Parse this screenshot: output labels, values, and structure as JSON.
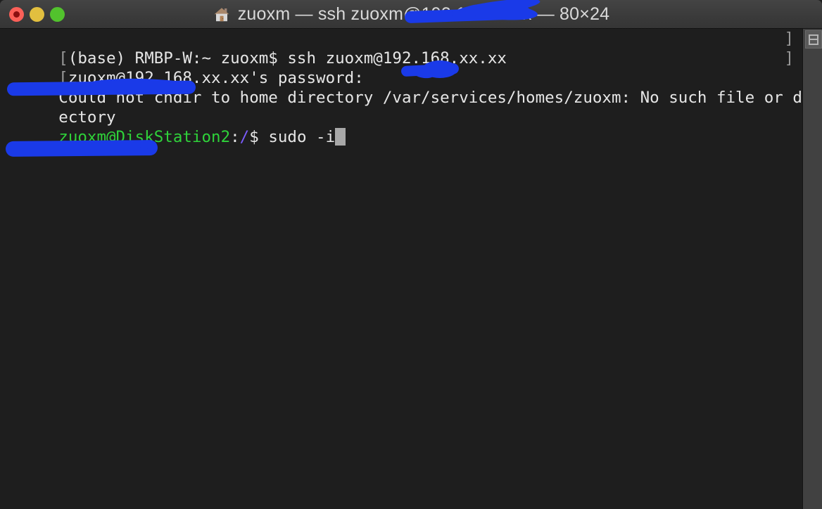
{
  "window": {
    "title_prefix": "zuoxm — ssh ",
    "title_redacted": "zuoxm@192.168.xx.xx",
    "title_suffix": " — 80×24",
    "title_full": "zuoxm — ssh zuoxm@192.168.xx.xx — 80×24",
    "home_icon": "house-icon",
    "size_label": "80×24"
  },
  "titlebar": {
    "close_label": "close",
    "minimize_label": "minimize",
    "maximize_label": "maximize"
  },
  "terminal": {
    "rows": 24,
    "cols": 80,
    "background": "#1e1e1e",
    "foreground": "#e6e6e6",
    "lines": [
      {
        "left_marker": "[",
        "right_marker": "]",
        "text": "(base) RMBP-W:~ zuoxm$ ssh zuoxm@192.168.xx.xx",
        "redacted": true
      },
      {
        "left_marker": "[",
        "right_marker": "]",
        "text": "zuoxm@192.168.xx.xx's password:",
        "redacted": true
      },
      {
        "left_marker": "",
        "right_marker": "",
        "text": "Could not chdir to home directory /var/services/homes/zuoxm: No such file or dir",
        "redacted": false
      },
      {
        "left_marker": "",
        "right_marker": "",
        "text": "ectory",
        "redacted": false
      }
    ],
    "prompt": {
      "host_redacted": "zuoxm@DiskStation",
      "host_tail": "2",
      "colon": ":",
      "path": "/",
      "sigil": "$ ",
      "command": "sudo -i",
      "cursor": "block"
    }
  },
  "sidebar": {
    "pane_button_label": "split-pane"
  },
  "colors": {
    "titlebar": "#3b3b3b",
    "terminal_bg": "#1e1e1e",
    "text": "#e6e6e6",
    "green": "#2fd23a",
    "violet": "#7b5cff",
    "redaction": "#1a3ae8",
    "cursor": "#a8a8a8",
    "marker": "#9a9a9a",
    "close": "#fc6058",
    "minimize": "#e2bf3f",
    "maximize": "#52c22d"
  }
}
